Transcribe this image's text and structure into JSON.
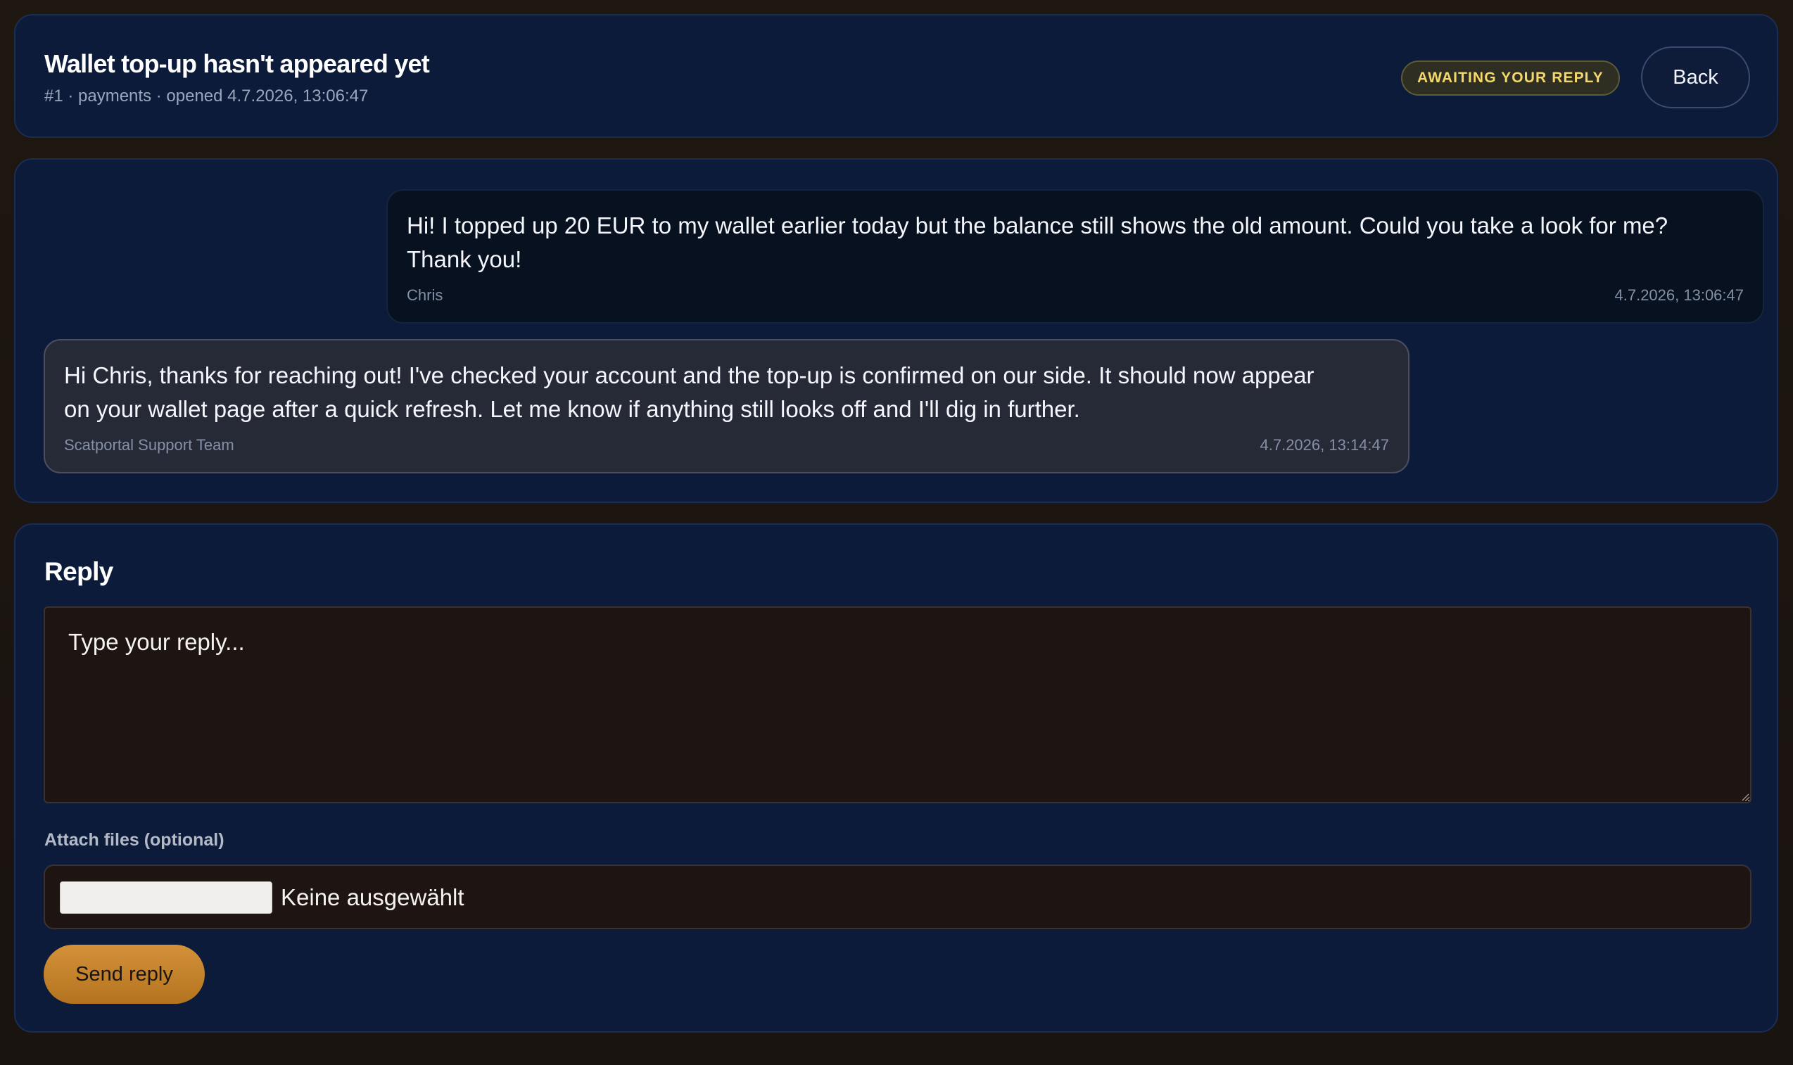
{
  "ticket": {
    "title": "Wallet top-up hasn't appeared yet",
    "meta": "#1 · payments · opened 4.7.2026, 13:06:47",
    "status": "AWAITING YOUR REPLY",
    "back_label": "Back"
  },
  "messages": [
    {
      "text": "Hi! I topped up 20 EUR to my wallet earlier today but the balance still shows the old amount. Could you take a look for me?\nThank you!",
      "author": "Chris",
      "time": "4.7.2026, 13:06:47"
    },
    {
      "text": "Hi Chris, thanks for reaching out! I've checked your account and the top-up is confirmed on our side. It should now appear\non your wallet page after a quick refresh. Let me know if anything still looks off and I'll dig in further.",
      "author": "Scatportal Support Team",
      "time": "4.7.2026, 13:14:47"
    }
  ],
  "reply": {
    "heading": "Reply",
    "placeholder": "Type your reply...",
    "value": "",
    "attach_label": "Attach files (optional)",
    "file_status": "Keine ausgewählt",
    "send_label": "Send reply"
  },
  "colors": {
    "page_bg": "#1c1510",
    "panel_bg": "#0d1b3a",
    "status_text": "#f5d86b",
    "send_button": "#c4832b"
  }
}
